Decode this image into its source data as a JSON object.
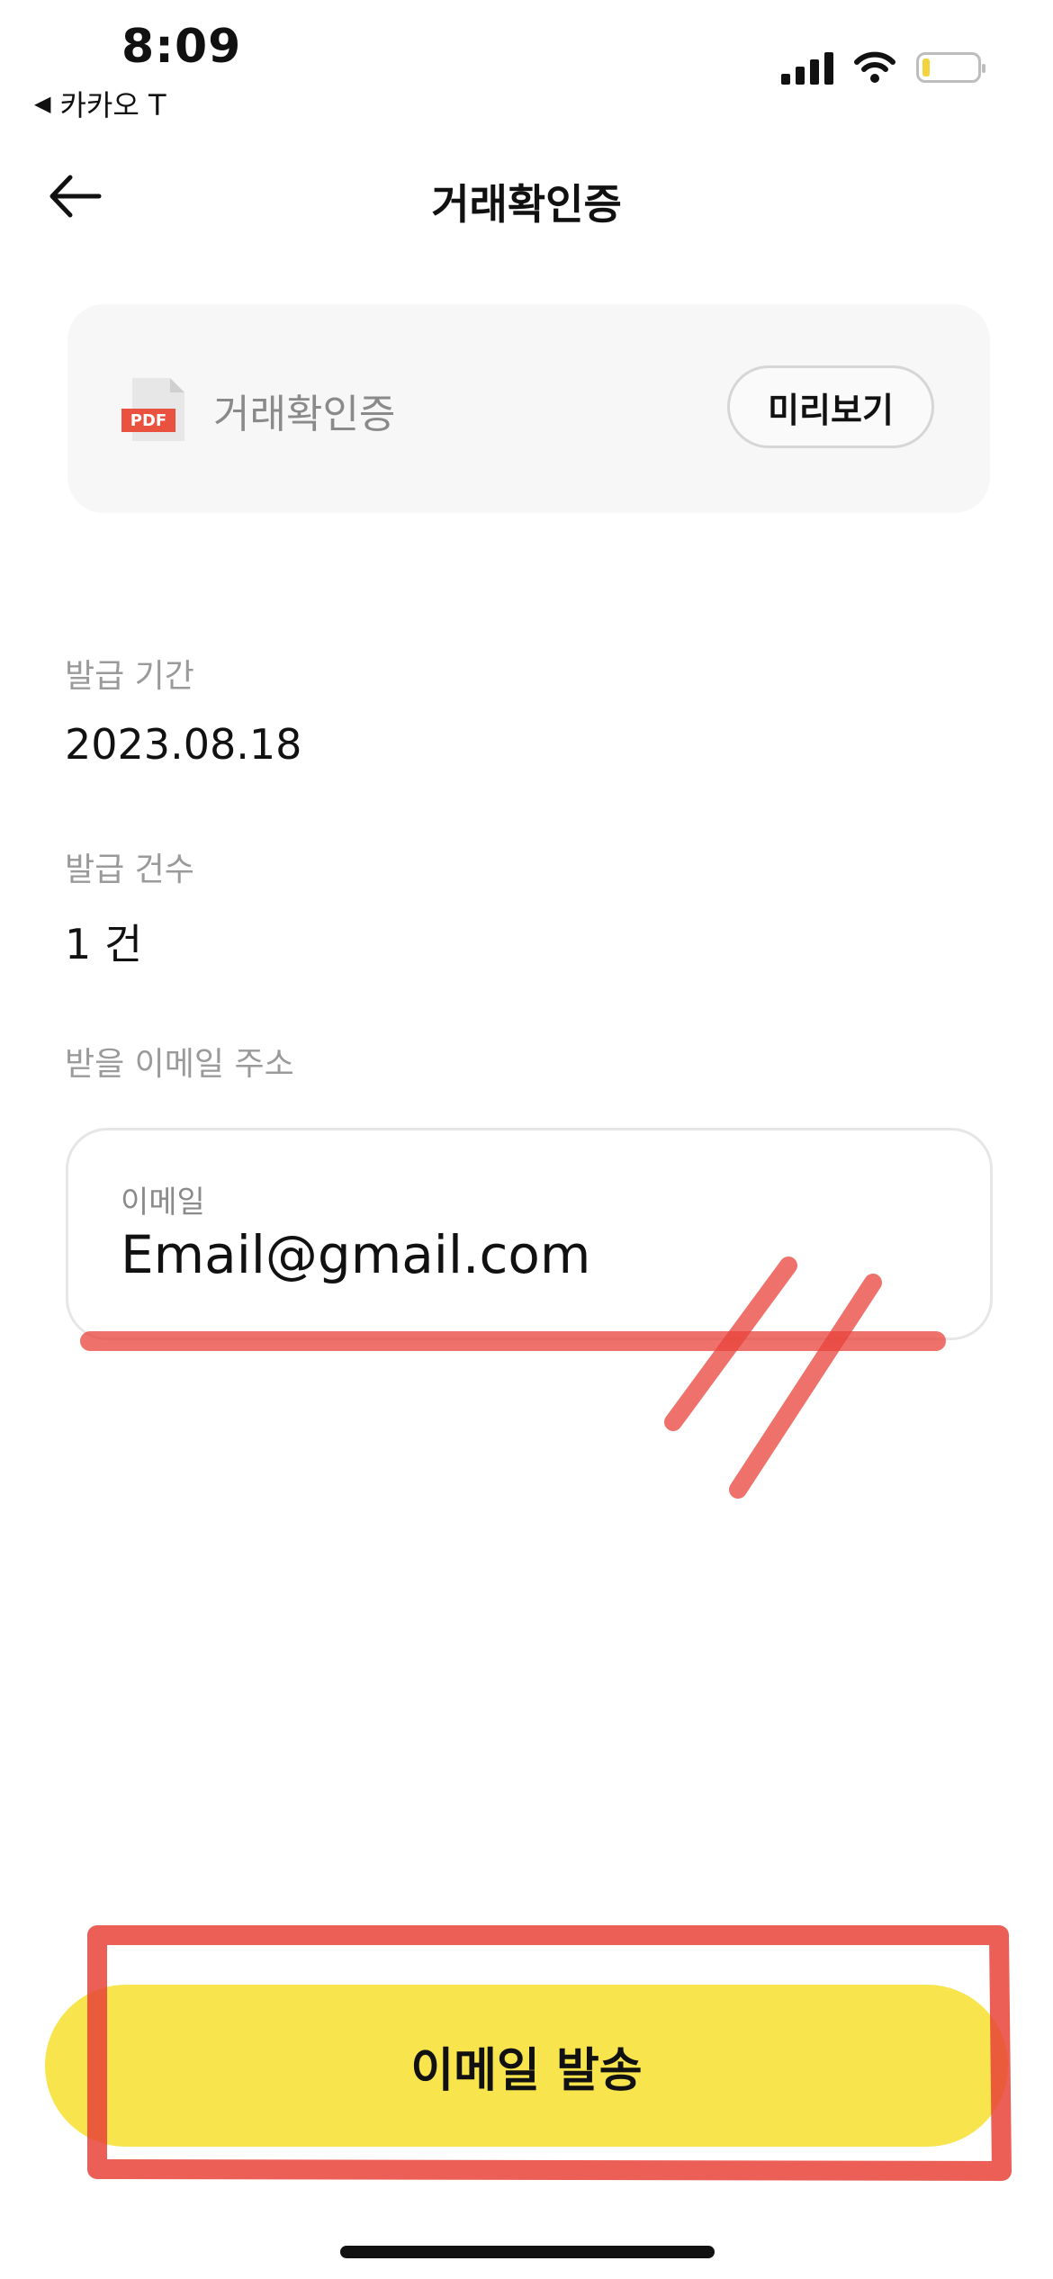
{
  "status_bar": {
    "time": "8:09",
    "back_app": "카카오 T",
    "icons": [
      "signal-icon",
      "wifi-icon",
      "battery-icon"
    ]
  },
  "header": {
    "title": "거래확인증",
    "back_icon": "back-arrow-icon"
  },
  "pdf_card": {
    "icon": "pdf-file-icon",
    "pdf_badge": "PDF",
    "file_name": "거래확인증",
    "preview_label": "미리보기"
  },
  "details": {
    "period_label": "발급 기간",
    "period_value": "2023.08.18",
    "count_label": "발급 건수",
    "count_value": "1 건",
    "email_section_label": "받을 이메일 주소"
  },
  "email_field": {
    "label": "이메일",
    "value": "Email@gmail.com"
  },
  "send_button": {
    "label": "이메일 발송"
  },
  "colors": {
    "accent_yellow": "#f8e44d",
    "annotation_red": "#e8433a",
    "card_bg": "#f7f7f7",
    "muted_text": "#9a9a9a"
  }
}
